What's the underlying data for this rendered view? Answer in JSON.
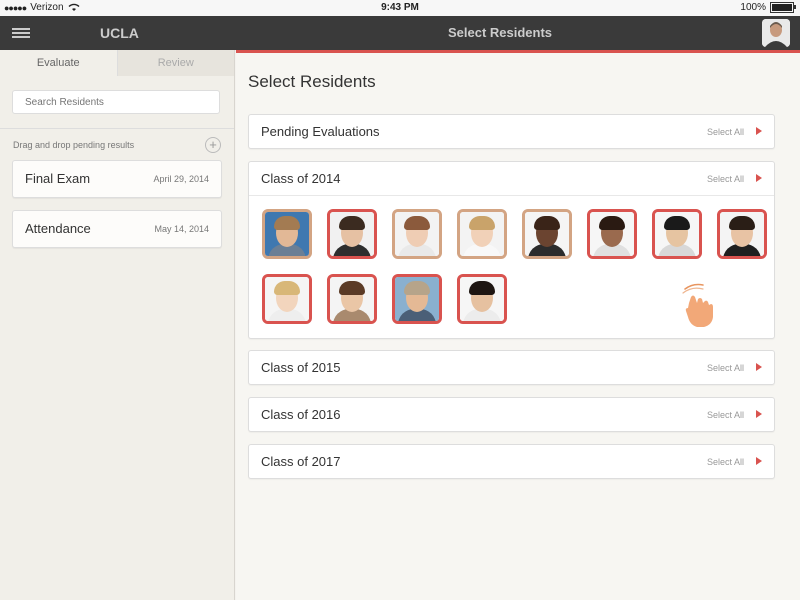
{
  "status_bar": {
    "carrier": "Verizon",
    "time": "9:43 PM",
    "battery": "100%"
  },
  "navbar": {
    "app_title": "UCLA",
    "title": "Select Residents"
  },
  "sidebar": {
    "tabs": [
      "Evaluate",
      "Review"
    ],
    "search_placeholder": "Search Residents",
    "drag_label": "Drag and drop pending results",
    "pending": [
      {
        "name": "Final Exam",
        "date": "April 29, 2014"
      },
      {
        "name": "Attendance",
        "date": "May 14, 2014"
      }
    ]
  },
  "main": {
    "page_title": "Select Residents",
    "select_all_label": "Select All",
    "groups": [
      {
        "title": "Pending Evaluations"
      },
      {
        "title": "Class of 2014"
      },
      {
        "title": "Class of 2015"
      },
      {
        "title": "Class of 2016"
      },
      {
        "title": "Class of 2017"
      }
    ]
  },
  "colors": {
    "accent": "#d9534f",
    "border_tan": "#d3a483",
    "navbar": "#3a3a3a"
  },
  "icons": [
    "menu-icon",
    "wifi-icon",
    "battery-icon",
    "add-icon",
    "arrow-right-icon",
    "hand-drag-icon"
  ]
}
